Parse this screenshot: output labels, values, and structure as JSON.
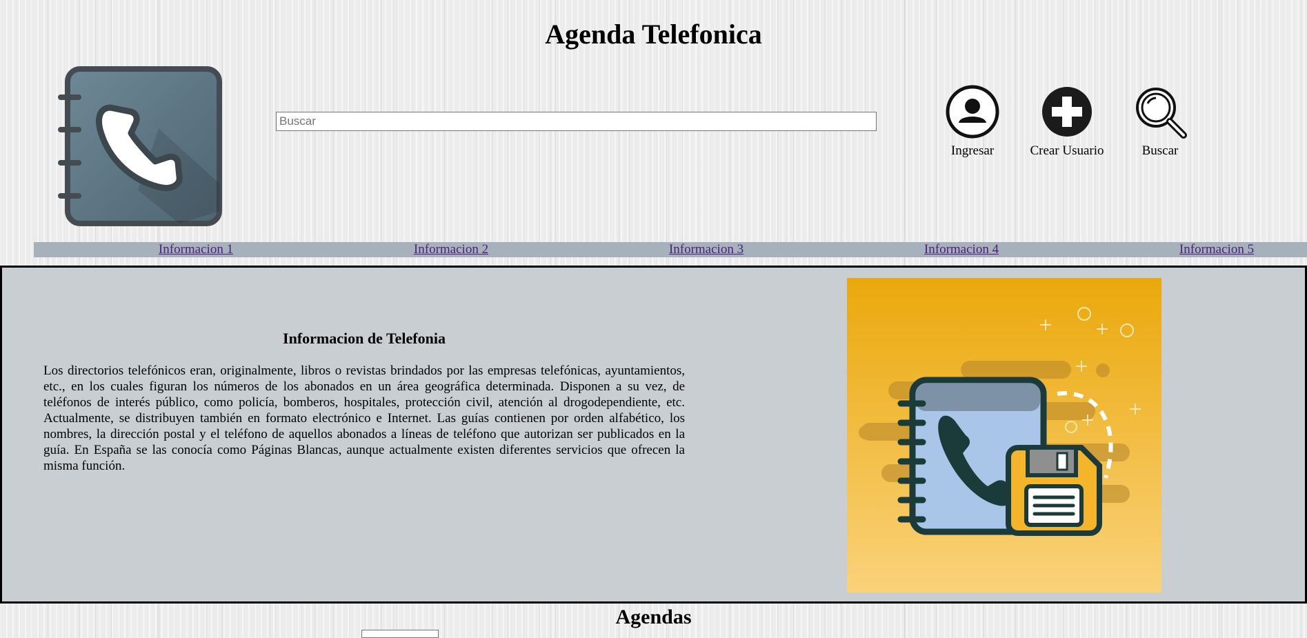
{
  "header": {
    "title": "Agenda Telefonica"
  },
  "search": {
    "placeholder": "Buscar"
  },
  "actions": [
    {
      "label": "Ingresar",
      "icon": "user-icon"
    },
    {
      "label": "Crear Usuario",
      "icon": "plus-icon"
    },
    {
      "label": "Buscar",
      "icon": "magnifier-icon"
    }
  ],
  "nav": {
    "links": [
      "Informacion 1",
      "Informacion 2",
      "Informacion 3",
      "Informacion 4",
      "Informacion 5"
    ]
  },
  "info": {
    "title": "Informacion de Telefonia",
    "text": "Los directorios telefónicos eran, originalmente, libros o revistas brindados por las empresas telefónicas, ayuntamientos, etc., en los cuales figuran los números de los abonados en un área geográfica determinada. Disponen a su vez, de teléfonos de interés público, como policía, bomberos, hospitales, protección civil, atención al drogodependiente, etc. Actualmente, se distribuyen también en formato electrónico e Internet. Las guías contienen por orden alfabético, los nombres, la dirección postal y el teléfono de aquellos abonados a líneas de teléfono que autorizan ser publicados en la guía. En España se las conocía como Páginas Blancas, aunque actualmente existen diferentes servicios que ofrecen la misma función."
  },
  "agendas": {
    "title": "Agendas"
  },
  "colors": {
    "nav_bg": "#a6b1bc",
    "section_bg": "#c9ced2",
    "link": "#4b1f7d",
    "logo": "#607d8b",
    "illustration_bg": "#f2b320"
  }
}
